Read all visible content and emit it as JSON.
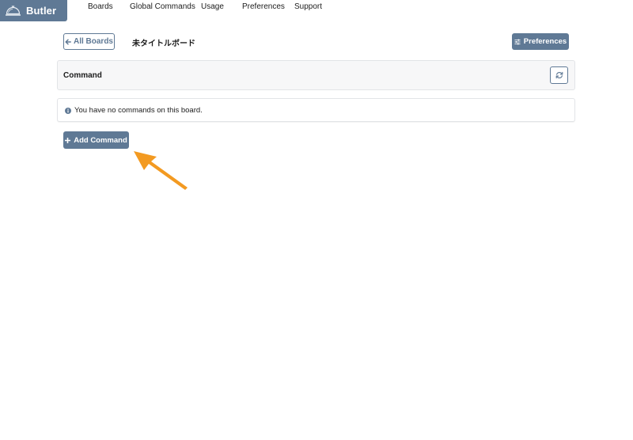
{
  "app": {
    "name": "Butler",
    "brand_color": "#5f7995"
  },
  "nav": {
    "items": [
      {
        "label": "Boards"
      },
      {
        "label": "Global Commands"
      },
      {
        "label": "Usage"
      },
      {
        "label": "Preferences"
      },
      {
        "label": "Support"
      }
    ]
  },
  "header": {
    "back_label": "All Boards",
    "board_title": "未タイトルボード",
    "preferences_label": "Preferences"
  },
  "panel": {
    "label": "Command"
  },
  "info": {
    "message": "You have no commands on this board."
  },
  "actions": {
    "add_label": "Add Command"
  },
  "annotation": {
    "arrow_color": "#f39a21"
  }
}
